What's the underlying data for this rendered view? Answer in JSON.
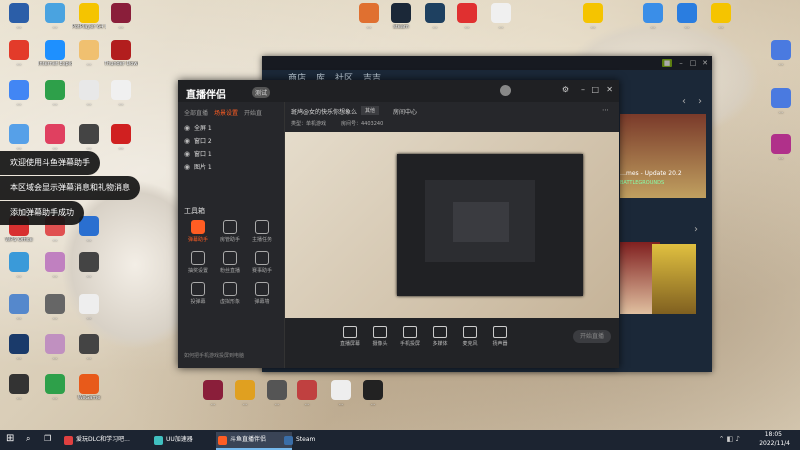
{
  "desktop_icons": [
    {
      "label": "…",
      "color": "#2b5ea8"
    },
    {
      "label": "…",
      "color": "#4aa3e0"
    },
    {
      "label": "PotPlayer 64 bit",
      "color": "#f5c400"
    },
    {
      "label": "…",
      "color": "#8a1e3a"
    },
    {
      "label": "…",
      "color": "#e33b2a"
    },
    {
      "label": "Internet Explorer",
      "color": "#1e90ff"
    },
    {
      "label": "…",
      "color": "#f0c070"
    },
    {
      "label": "Thunder Downloader",
      "color": "#b21e1e"
    },
    {
      "label": "…",
      "color": "#4286f4"
    },
    {
      "label": "…",
      "color": "#2ea04a"
    },
    {
      "label": "…",
      "color": "#e8e8e8"
    },
    {
      "label": "…",
      "color": "#f0f0f0"
    },
    {
      "label": "…",
      "color": "#56a0e8"
    },
    {
      "label": "…",
      "color": "#e04060"
    },
    {
      "label": "…",
      "color": "#444444"
    },
    {
      "label": "…",
      "color": "#d02020"
    },
    {
      "label": "WPS Office",
      "color": "#d83030"
    },
    {
      "label": "…",
      "color": "#e05050"
    },
    {
      "label": "…",
      "color": "#2a6fd0"
    },
    {
      "label": "…",
      "color": "#3a9ad9"
    },
    {
      "label": "…",
      "color": "#c080c0"
    },
    {
      "label": "…",
      "color": "#444444"
    },
    {
      "label": "…",
      "color": "#5588cc"
    },
    {
      "label": "…",
      "color": "#666666"
    },
    {
      "label": "…",
      "color": "#eeeeee"
    },
    {
      "label": "…",
      "color": "#1a3a6a"
    },
    {
      "label": "…",
      "color": "#c090c0"
    },
    {
      "label": "…",
      "color": "#444444"
    },
    {
      "label": "…",
      "color": "#333333"
    },
    {
      "label": "…",
      "color": "#2ea04a"
    },
    {
      "label": "WeGame",
      "color": "#e85a1a"
    },
    {
      "label": "…",
      "color": "#e07030"
    },
    {
      "label": "steam",
      "color": "#1b2838"
    },
    {
      "label": "…",
      "color": "#1e4060"
    },
    {
      "label": "…",
      "color": "#e03030"
    },
    {
      "label": "…",
      "color": "#f0f0f0"
    },
    {
      "label": "…",
      "color": "#f5c400"
    },
    {
      "label": "…",
      "color": "#3a8ee8"
    },
    {
      "label": "…",
      "color": "#2a7de0"
    },
    {
      "label": "…",
      "color": "#f5c400"
    },
    {
      "label": "…",
      "color": "#4a7ae0"
    },
    {
      "label": "…",
      "color": "#4a7ae0"
    },
    {
      "label": "…",
      "color": "#b0308a"
    },
    {
      "label": "…",
      "color": "#8a1e3a"
    },
    {
      "label": "…",
      "color": "#e0a020"
    },
    {
      "label": "…",
      "color": "#555555"
    },
    {
      "label": "…",
      "color": "#c04040"
    },
    {
      "label": "…",
      "color": "#eeeeee"
    },
    {
      "label": "…",
      "color": "#222222"
    }
  ],
  "notifications": [
    "欢迎使用斗鱼弹幕助手",
    "本区域会显示弹幕消息和礼物消息",
    "添加弹幕助手成功"
  ],
  "steam": {
    "nav": [
      "商店",
      "库",
      "社区",
      "吉吉"
    ],
    "game_title": "…mes - Update 20.2",
    "game_sub": "BATTLEGROUNDS"
  },
  "douyu": {
    "logo": "直播伴侣",
    "badge": "测试",
    "side_tabs": [
      "全部直播",
      "场景设置",
      "开始直"
    ],
    "scenes": [
      "全屏 1",
      "窗口 2",
      "窗口 1",
      "图片 1"
    ],
    "tools_title": "工具箱",
    "tools": [
      "弹幕助手",
      "房管助手",
      "主播任务",
      "抽奖设置",
      "粉丝直播",
      "赛事助手",
      "投弹幕",
      "虚拟形象",
      "弹幕墙",
      "…",
      "…",
      "…"
    ],
    "room_title": "斑鸠@女的快乐你想象么",
    "room_tag": "其他",
    "room_center": "房间中心",
    "room_cat": "类型：单机游戏",
    "room_id": "房间号：4403240",
    "footer_hint": "如何把手机游戏投屏到电脑",
    "controls": [
      "直播屏幕",
      "摄像头",
      "手机投屏",
      "多媒体",
      "麦克风",
      "扬声器"
    ],
    "live_button": "开始直播"
  },
  "taskbar": {
    "items": [
      "爱玩DLC和学习吧...",
      "UU加速器",
      "斗鱼直播伴侣",
      "Steam"
    ],
    "time": "18:05",
    "date": "2022/11/4"
  }
}
